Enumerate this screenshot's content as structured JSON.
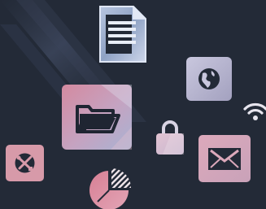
{
  "scene": {
    "background_color": "#232a37",
    "accent_colors": [
      "#d98fa2",
      "#b9b7cf",
      "#8fa2c4",
      "#e9c0cf"
    ]
  },
  "icons": {
    "document": "document-icon",
    "folder": "folder-icon",
    "globe": "globe-icon",
    "wifi": "wifi-icon",
    "lock": "lock-icon",
    "mail": "mail-icon",
    "tools": "tools-icon",
    "pie_chart": "pie-chart-icon"
  }
}
